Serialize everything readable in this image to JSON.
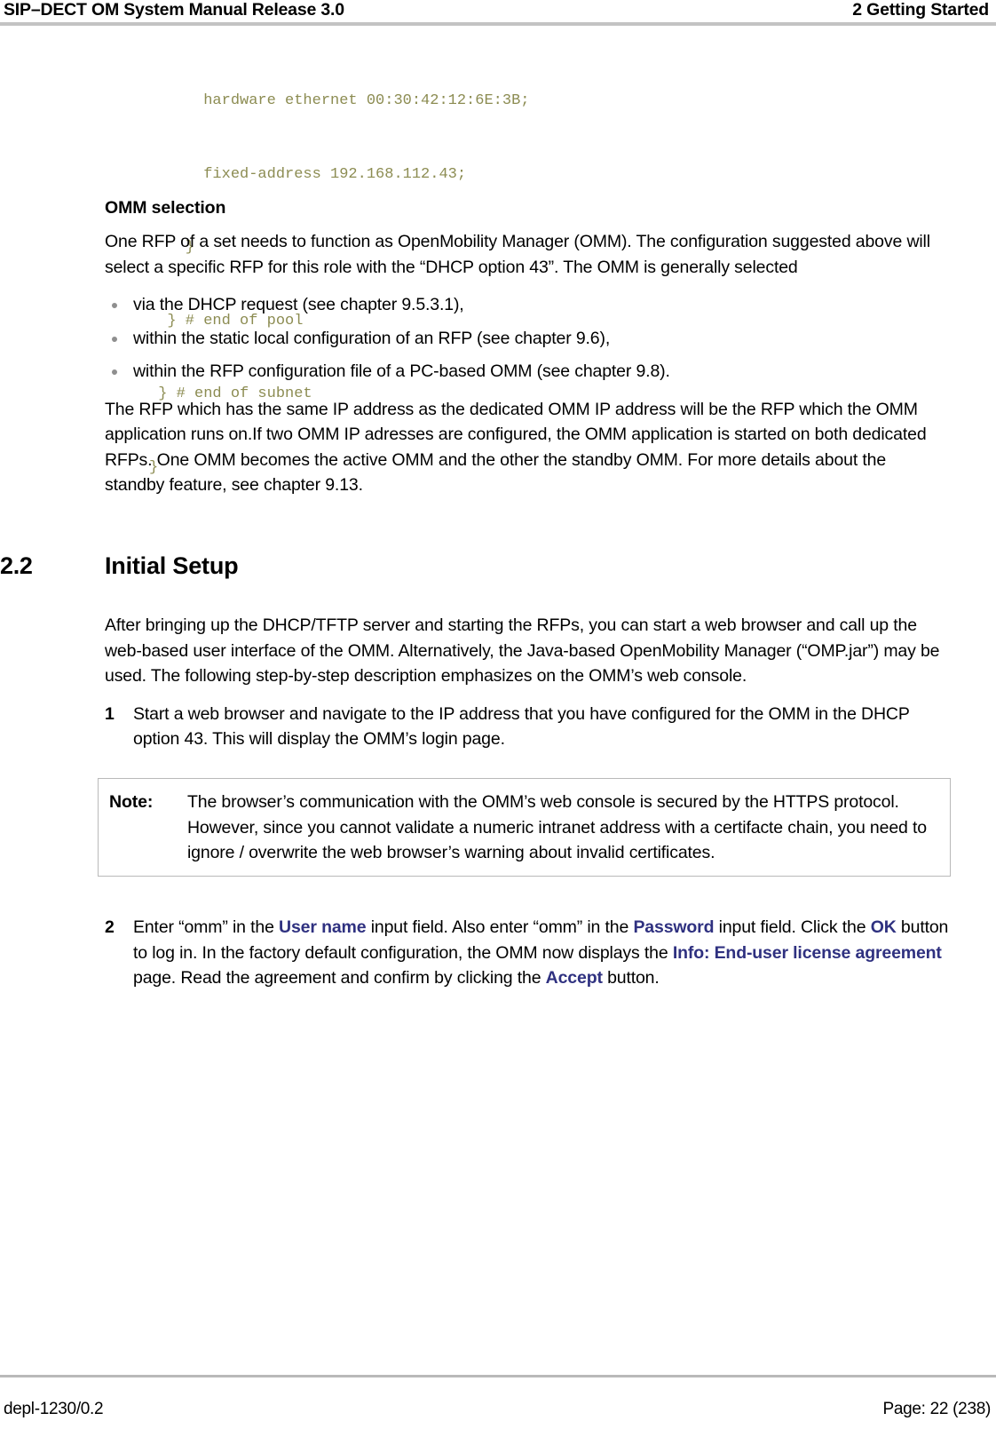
{
  "header": {
    "left": "SIP–DECT OM System Manual Release 3.0",
    "right": "2 Getting Started"
  },
  "code_block": {
    "color": "#8c8c52",
    "lines": [
      "      hardware ethernet 00:30:42:12:6E:3B;",
      "      fixed-address 192.168.112.43;",
      "    }",
      "  } # end of pool",
      " } # end of subnet",
      "}"
    ]
  },
  "omm_selection": {
    "heading": "OMM selection",
    "intro": "One RFP of a set needs to function as OpenMobility Manager (OMM). The configuration suggested above will select a specific RFP for this role with the “DHCP option 43”. The OMM is generally selected",
    "bullets": [
      "via the DHCP request (see chapter 9.5.3.1),",
      "within the static local configuration of an RFP (see chapter 9.6),",
      "within the RFP configuration file of a PC-based OMM (see chapter 9.8)."
    ],
    "closing": "The RFP which has the same IP address as the dedicated OMM IP address will be the RFP which the OMM application runs on.If two OMM IP adresses are configured, the OMM application is started on both dedicated RFPs. One OMM becomes the active OMM and the other the standby OMM. For more details about the standby feature, see chapter 9.13."
  },
  "section": {
    "number": "2.2",
    "title": "Initial Setup",
    "intro": "After bringing up the DHCP/TFTP server and starting the RFPs, you can start a web browser and call up the web-based user interface of the OMM. Alternatively, the Java-based OpenMobility Manager (“OMP.jar”) may be used. The following step-by-step description emphasizes on the OMM’s web console."
  },
  "steps": [
    {
      "number": "1",
      "text": "Start a web browser and navigate to the IP address that you have configured for the OMM in the DHCP option 43. This will display the OMM’s login page."
    },
    {
      "number": "2",
      "segments": [
        {
          "kind": "plain",
          "text": "Enter “omm” in the "
        },
        {
          "kind": "ui",
          "text": "User name"
        },
        {
          "kind": "plain",
          "text": " input field. Also enter “omm” in the "
        },
        {
          "kind": "ui",
          "text": "Password"
        },
        {
          "kind": "plain",
          "text": " input field. Click the "
        },
        {
          "kind": "ui",
          "text": "OK"
        },
        {
          "kind": "plain",
          "text": " button to log in. In the factory default configuration, the OMM now displays the "
        },
        {
          "kind": "ui",
          "text": "Info: End-user license agreement"
        },
        {
          "kind": "plain",
          "text": " page. Read the agreement and confirm by clicking the "
        },
        {
          "kind": "ui",
          "text": "Accept"
        },
        {
          "kind": "plain",
          "text": " button."
        }
      ]
    }
  ],
  "note": {
    "label": "Note:",
    "text": "The browser’s communication with the OMM’s web console is secured by the HTTPS protocol. However, since you cannot validate a numeric intranet address with a certifacte chain, you need to ignore / overwrite the web browser’s warning about invalid certificates."
  },
  "footer": {
    "left": "depl-1230/0.2",
    "right": "Page: 22 (238)"
  },
  "colors": {
    "ui_term": "#2f3180",
    "code": "#8c8c52",
    "rule": "#c3c3c3"
  }
}
